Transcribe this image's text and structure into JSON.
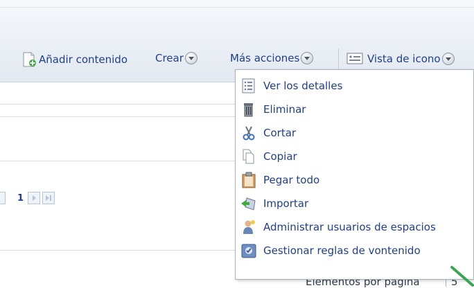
{
  "toolbar": {
    "add_content_label": "Añadir contenido",
    "create_label": "Crear",
    "more_actions_label": "Más acciones",
    "view_label": "Vista de icono"
  },
  "pager": {
    "current_page": "1"
  },
  "menu": {
    "items": [
      {
        "label": "Ver los detalles",
        "icon": "details-list-icon"
      },
      {
        "label": "Eliminar",
        "icon": "trash-icon"
      },
      {
        "label": "Cortar",
        "icon": "scissors-icon"
      },
      {
        "label": "Copiar",
        "icon": "copy-icon"
      },
      {
        "label": "Pegar todo",
        "icon": "clipboard-icon"
      },
      {
        "label": "Importar",
        "icon": "import-icon"
      },
      {
        "label": "Administrar usuarios de espacios",
        "icon": "users-icon"
      },
      {
        "label": "Gestionar reglas de vontenido",
        "icon": "rules-icon"
      }
    ]
  },
  "footer": {
    "items_per_page_label": "Elementos por página",
    "items_per_page_value": "5"
  },
  "colors": {
    "link": "#1e3f8f",
    "pointer_arrow": "#3aa655"
  }
}
